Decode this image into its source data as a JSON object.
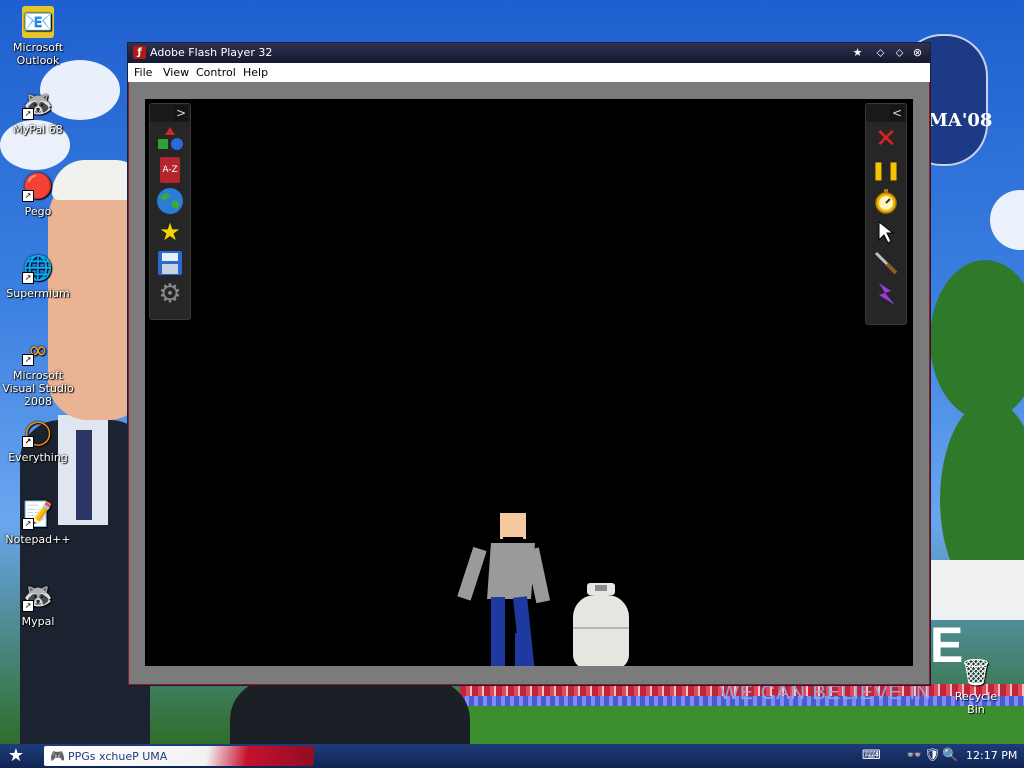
{
  "desktop": {
    "icons": [
      {
        "label": "Microsoft Outlook",
        "glyph": "📧"
      },
      {
        "label": "MyPal 68",
        "glyph": "🦝"
      },
      {
        "label": "Pego",
        "glyph": "🔴"
      },
      {
        "label": "Supermium",
        "glyph": "🌐"
      },
      {
        "label": "Microsoft Visual Studio 2008",
        "glyph": "∞"
      },
      {
        "label": "Everything",
        "glyph": "◯"
      },
      {
        "label": "Notepad++",
        "glyph": "📝"
      },
      {
        "label": "Mypal",
        "glyph": "🦝"
      }
    ],
    "recycle_bin": {
      "label": "Recycle Bin",
      "glyph": "🗑"
    },
    "wallpaper_text": {
      "slogan": "WE CAN BELIEVE IN",
      "big_letter": "E",
      "logo_text": "MA'08"
    }
  },
  "window": {
    "title": "Adobe Flash Player 32",
    "app_glyph": "ƒ",
    "title_buttons": [
      "★",
      "⬦",
      "⬦",
      "⊗"
    ],
    "menu": [
      "File",
      "View",
      "Control",
      "Help"
    ]
  },
  "game": {
    "left_toolbar": {
      "collapse_glyph": ">",
      "tools": [
        {
          "name": "shapes",
          "glyph": "▲"
        },
        {
          "name": "a-z",
          "glyph": "A-Z"
        },
        {
          "name": "world",
          "glyph": "🌍"
        },
        {
          "name": "favorites",
          "glyph": "★"
        },
        {
          "name": "save",
          "glyph": "💾"
        },
        {
          "name": "settings",
          "glyph": "⚙"
        }
      ]
    },
    "right_toolbar": {
      "collapse_glyph": "<",
      "tools": [
        {
          "name": "delete",
          "glyph": "✕"
        },
        {
          "name": "pause",
          "glyph": "❚❚"
        },
        {
          "name": "timer",
          "glyph": "⏱"
        },
        {
          "name": "pointer",
          "glyph": "➤"
        },
        {
          "name": "knife",
          "glyph": "🔪"
        },
        {
          "name": "lightning",
          "glyph": "⚡"
        }
      ]
    },
    "colors": {
      "stage": "#000000",
      "skin": "#f5c8a0",
      "shirt": "#9a9a9a",
      "pants": "#1e3aa0",
      "tank": "#e8e6e0"
    }
  },
  "taskbar": {
    "start_glyph": "★",
    "task_label": "PPGs xchueP UMA",
    "task_glyph": "🎮",
    "tray": [
      "⌨",
      "👓",
      "🛡",
      "🔍"
    ],
    "clock": "12:17 PM"
  }
}
